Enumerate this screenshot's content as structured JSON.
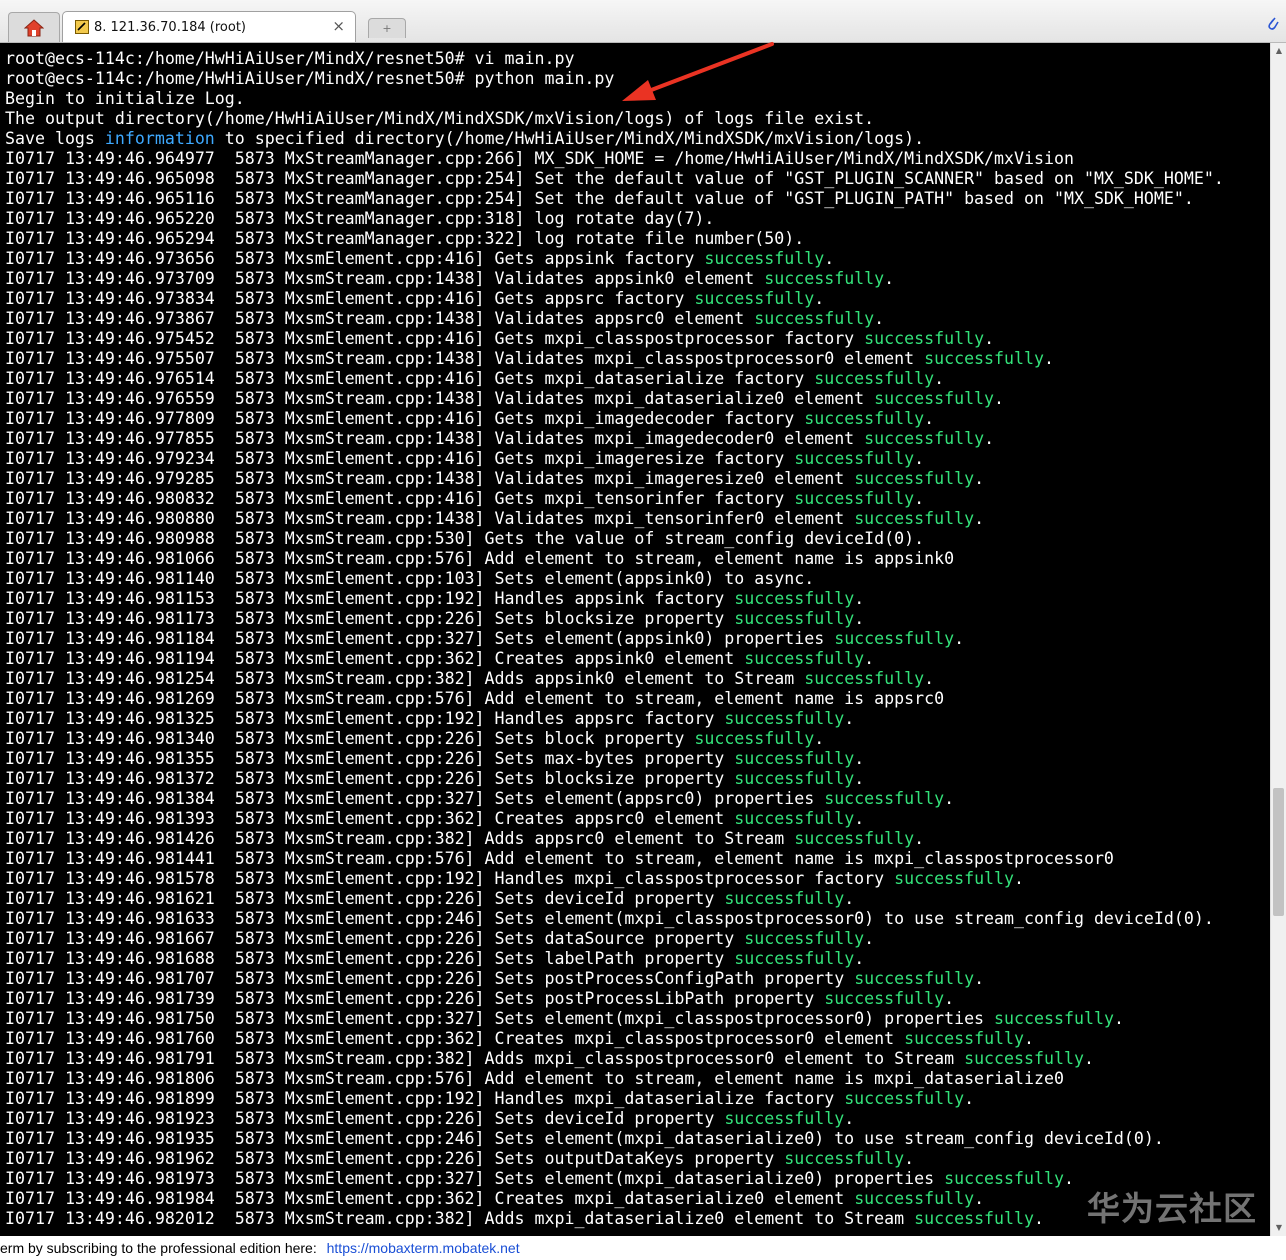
{
  "tabbar": {
    "home_icon": "home-icon",
    "session_icon": "terminal-session-icon",
    "session_label": "8. 121.36.70.184 (root)",
    "close_label": "×",
    "new_tab_label": "+",
    "attach_icon": "paperclip-icon"
  },
  "colors": {
    "terminal_bg": "#000000",
    "terminal_text": "#ffffff",
    "success_text": "#33e27a",
    "highlight_text": "#3ea9ff",
    "annotation_arrow": "#ea3323",
    "link": "#1a4fd6"
  },
  "terminal": {
    "lines": [
      [
        {
          "t": "root@ecs-114c:/home/HwHiAiUser/MindX/resnet50# vi main.py"
        }
      ],
      [
        {
          "t": "root@ecs-114c:/home/HwHiAiUser/MindX/resnet50# python main.py"
        }
      ],
      [
        {
          "t": "Begin to initialize Log."
        }
      ],
      [
        {
          "t": "The output directory(/home/HwHiAiUser/MindX/MindXSDK/mxVision/logs) of logs file exist."
        }
      ],
      [
        {
          "t": "Save logs "
        },
        {
          "t": "information",
          "c": "hl"
        },
        {
          "t": " to specified directory(/home/HwHiAiUser/MindX/MindXSDK/mxVision/logs)."
        }
      ],
      [
        {
          "t": "I0717 13:49:46.964977  5873 MxStreamManager.cpp:266] MX_SDK_HOME = /home/HwHiAiUser/MindX/MindXSDK/mxVision"
        }
      ],
      [
        {
          "t": "I0717 13:49:46.965098  5873 MxStreamManager.cpp:254] Set the default value of \"GST_PLUGIN_SCANNER\" based on \"MX_SDK_HOME\"."
        }
      ],
      [
        {
          "t": "I0717 13:49:46.965116  5873 MxStreamManager.cpp:254] Set the default value of \"GST_PLUGIN_PATH\" based on \"MX_SDK_HOME\"."
        }
      ],
      [
        {
          "t": "I0717 13:49:46.965220  5873 MxStreamManager.cpp:318] log rotate day(7)."
        }
      ],
      [
        {
          "t": "I0717 13:49:46.965294  5873 MxStreamManager.cpp:322] log rotate file number(50)."
        }
      ],
      [
        {
          "t": "I0717 13:49:46.973656  5873 MxsmElement.cpp:416] Gets appsink factory "
        },
        {
          "t": "successfully",
          "c": "ok"
        },
        {
          "t": "."
        }
      ],
      [
        {
          "t": "I0717 13:49:46.973709  5873 MxsmStream.cpp:1438] Validates appsink0 element "
        },
        {
          "t": "successfully",
          "c": "ok"
        },
        {
          "t": "."
        }
      ],
      [
        {
          "t": "I0717 13:49:46.973834  5873 MxsmElement.cpp:416] Gets appsrc factory "
        },
        {
          "t": "successfully",
          "c": "ok"
        },
        {
          "t": "."
        }
      ],
      [
        {
          "t": "I0717 13:49:46.973867  5873 MxsmStream.cpp:1438] Validates appsrc0 element "
        },
        {
          "t": "successfully",
          "c": "ok"
        },
        {
          "t": "."
        }
      ],
      [
        {
          "t": "I0717 13:49:46.975452  5873 MxsmElement.cpp:416] Gets mxpi_classpostprocessor factory "
        },
        {
          "t": "successfully",
          "c": "ok"
        },
        {
          "t": "."
        }
      ],
      [
        {
          "t": "I0717 13:49:46.975507  5873 MxsmStream.cpp:1438] Validates mxpi_classpostprocessor0 element "
        },
        {
          "t": "successfully",
          "c": "ok"
        },
        {
          "t": "."
        }
      ],
      [
        {
          "t": "I0717 13:49:46.976514  5873 MxsmElement.cpp:416] Gets mxpi_dataserialize factory "
        },
        {
          "t": "successfully",
          "c": "ok"
        },
        {
          "t": "."
        }
      ],
      [
        {
          "t": "I0717 13:49:46.976559  5873 MxsmStream.cpp:1438] Validates mxpi_dataserialize0 element "
        },
        {
          "t": "successfully",
          "c": "ok"
        },
        {
          "t": "."
        }
      ],
      [
        {
          "t": "I0717 13:49:46.977809  5873 MxsmElement.cpp:416] Gets mxpi_imagedecoder factory "
        },
        {
          "t": "successfully",
          "c": "ok"
        },
        {
          "t": "."
        }
      ],
      [
        {
          "t": "I0717 13:49:46.977855  5873 MxsmStream.cpp:1438] Validates mxpi_imagedecoder0 element "
        },
        {
          "t": "successfully",
          "c": "ok"
        },
        {
          "t": "."
        }
      ],
      [
        {
          "t": "I0717 13:49:46.979234  5873 MxsmElement.cpp:416] Gets mxpi_imageresize factory "
        },
        {
          "t": "successfully",
          "c": "ok"
        },
        {
          "t": "."
        }
      ],
      [
        {
          "t": "I0717 13:49:46.979285  5873 MxsmStream.cpp:1438] Validates mxpi_imageresize0 element "
        },
        {
          "t": "successfully",
          "c": "ok"
        },
        {
          "t": "."
        }
      ],
      [
        {
          "t": "I0717 13:49:46.980832  5873 MxsmElement.cpp:416] Gets mxpi_tensorinfer factory "
        },
        {
          "t": "successfully",
          "c": "ok"
        },
        {
          "t": "."
        }
      ],
      [
        {
          "t": "I0717 13:49:46.980880  5873 MxsmStream.cpp:1438] Validates mxpi_tensorinfer0 element "
        },
        {
          "t": "successfully",
          "c": "ok"
        },
        {
          "t": "."
        }
      ],
      [
        {
          "t": "I0717 13:49:46.980988  5873 MxsmStream.cpp:530] Gets the value of stream_config deviceId(0)."
        }
      ],
      [
        {
          "t": "I0717 13:49:46.981066  5873 MxsmStream.cpp:576] Add element to stream, element name is appsink0"
        }
      ],
      [
        {
          "t": "I0717 13:49:46.981140  5873 MxsmElement.cpp:103] Sets element(appsink0) to async."
        }
      ],
      [
        {
          "t": "I0717 13:49:46.981153  5873 MxsmElement.cpp:192] Handles appsink factory "
        },
        {
          "t": "successfully",
          "c": "ok"
        },
        {
          "t": "."
        }
      ],
      [
        {
          "t": "I0717 13:49:46.981173  5873 MxsmElement.cpp:226] Sets blocksize property "
        },
        {
          "t": "successfully",
          "c": "ok"
        },
        {
          "t": "."
        }
      ],
      [
        {
          "t": "I0717 13:49:46.981184  5873 MxsmElement.cpp:327] Sets element(appsink0) properties "
        },
        {
          "t": "successfully",
          "c": "ok"
        },
        {
          "t": "."
        }
      ],
      [
        {
          "t": "I0717 13:49:46.981194  5873 MxsmElement.cpp:362] Creates appsink0 element "
        },
        {
          "t": "successfully",
          "c": "ok"
        },
        {
          "t": "."
        }
      ],
      [
        {
          "t": "I0717 13:49:46.981254  5873 MxsmStream.cpp:382] Adds appsink0 element to Stream "
        },
        {
          "t": "successfully",
          "c": "ok"
        },
        {
          "t": "."
        }
      ],
      [
        {
          "t": "I0717 13:49:46.981269  5873 MxsmStream.cpp:576] Add element to stream, element name is appsrc0"
        }
      ],
      [
        {
          "t": "I0717 13:49:46.981325  5873 MxsmElement.cpp:192] Handles appsrc factory "
        },
        {
          "t": "successfully",
          "c": "ok"
        },
        {
          "t": "."
        }
      ],
      [
        {
          "t": "I0717 13:49:46.981340  5873 MxsmElement.cpp:226] Sets block property "
        },
        {
          "t": "successfully",
          "c": "ok"
        },
        {
          "t": "."
        }
      ],
      [
        {
          "t": "I0717 13:49:46.981355  5873 MxsmElement.cpp:226] Sets max-bytes property "
        },
        {
          "t": "successfully",
          "c": "ok"
        },
        {
          "t": "."
        }
      ],
      [
        {
          "t": "I0717 13:49:46.981372  5873 MxsmElement.cpp:226] Sets blocksize property "
        },
        {
          "t": "successfully",
          "c": "ok"
        },
        {
          "t": "."
        }
      ],
      [
        {
          "t": "I0717 13:49:46.981384  5873 MxsmElement.cpp:327] Sets element(appsrc0) properties "
        },
        {
          "t": "successfully",
          "c": "ok"
        },
        {
          "t": "."
        }
      ],
      [
        {
          "t": "I0717 13:49:46.981393  5873 MxsmElement.cpp:362] Creates appsrc0 element "
        },
        {
          "t": "successfully",
          "c": "ok"
        },
        {
          "t": "."
        }
      ],
      [
        {
          "t": "I0717 13:49:46.981426  5873 MxsmStream.cpp:382] Adds appsrc0 element to Stream "
        },
        {
          "t": "successfully",
          "c": "ok"
        },
        {
          "t": "."
        }
      ],
      [
        {
          "t": "I0717 13:49:46.981441  5873 MxsmStream.cpp:576] Add element to stream, element name is mxpi_classpostprocessor0"
        }
      ],
      [
        {
          "t": "I0717 13:49:46.981578  5873 MxsmElement.cpp:192] Handles mxpi_classpostprocessor factory "
        },
        {
          "t": "successfully",
          "c": "ok"
        },
        {
          "t": "."
        }
      ],
      [
        {
          "t": "I0717 13:49:46.981621  5873 MxsmElement.cpp:226] Sets deviceId property "
        },
        {
          "t": "successfully",
          "c": "ok"
        },
        {
          "t": "."
        }
      ],
      [
        {
          "t": "I0717 13:49:46.981633  5873 MxsmElement.cpp:246] Sets element(mxpi_classpostprocessor0) to use stream_config deviceId(0)."
        }
      ],
      [
        {
          "t": "I0717 13:49:46.981667  5873 MxsmElement.cpp:226] Sets dataSource property "
        },
        {
          "t": "successfully",
          "c": "ok"
        },
        {
          "t": "."
        }
      ],
      [
        {
          "t": "I0717 13:49:46.981688  5873 MxsmElement.cpp:226] Sets labelPath property "
        },
        {
          "t": "successfully",
          "c": "ok"
        },
        {
          "t": "."
        }
      ],
      [
        {
          "t": "I0717 13:49:46.981707  5873 MxsmElement.cpp:226] Sets postProcessConfigPath property "
        },
        {
          "t": "successfully",
          "c": "ok"
        },
        {
          "t": "."
        }
      ],
      [
        {
          "t": "I0717 13:49:46.981739  5873 MxsmElement.cpp:226] Sets postProcessLibPath property "
        },
        {
          "t": "successfully",
          "c": "ok"
        },
        {
          "t": "."
        }
      ],
      [
        {
          "t": "I0717 13:49:46.981750  5873 MxsmElement.cpp:327] Sets element(mxpi_classpostprocessor0) properties "
        },
        {
          "t": "successfully",
          "c": "ok"
        },
        {
          "t": "."
        }
      ],
      [
        {
          "t": "I0717 13:49:46.981760  5873 MxsmElement.cpp:362] Creates mxpi_classpostprocessor0 element "
        },
        {
          "t": "successfully",
          "c": "ok"
        },
        {
          "t": "."
        }
      ],
      [
        {
          "t": "I0717 13:49:46.981791  5873 MxsmStream.cpp:382] Adds mxpi_classpostprocessor0 element to Stream "
        },
        {
          "t": "successfully",
          "c": "ok"
        },
        {
          "t": "."
        }
      ],
      [
        {
          "t": "I0717 13:49:46.981806  5873 MxsmStream.cpp:576] Add element to stream, element name is mxpi_dataserialize0"
        }
      ],
      [
        {
          "t": "I0717 13:49:46.981899  5873 MxsmElement.cpp:192] Handles mxpi_dataserialize factory "
        },
        {
          "t": "successfully",
          "c": "ok"
        },
        {
          "t": "."
        }
      ],
      [
        {
          "t": "I0717 13:49:46.981923  5873 MxsmElement.cpp:226] Sets deviceId property "
        },
        {
          "t": "successfully",
          "c": "ok"
        },
        {
          "t": "."
        }
      ],
      [
        {
          "t": "I0717 13:49:46.981935  5873 MxsmElement.cpp:246] Sets element(mxpi_dataserialize0) to use stream_config deviceId(0)."
        }
      ],
      [
        {
          "t": "I0717 13:49:46.981962  5873 MxsmElement.cpp:226] Sets outputDataKeys property "
        },
        {
          "t": "successfully",
          "c": "ok"
        },
        {
          "t": "."
        }
      ],
      [
        {
          "t": "I0717 13:49:46.981973  5873 MxsmElement.cpp:327] Sets element(mxpi_dataserialize0) properties "
        },
        {
          "t": "successfully",
          "c": "ok"
        },
        {
          "t": "."
        }
      ],
      [
        {
          "t": "I0717 13:49:46.981984  5873 MxsmElement.cpp:362] Creates mxpi_dataserialize0 element "
        },
        {
          "t": "successfully",
          "c": "ok"
        },
        {
          "t": "."
        }
      ],
      [
        {
          "t": "I0717 13:49:46.982012  5873 MxsmStream.cpp:382] Adds mxpi_dataserialize0 element to Stream "
        },
        {
          "t": "successfully",
          "c": "ok"
        },
        {
          "t": "."
        }
      ]
    ]
  },
  "watermark": {
    "text": "华为云社区"
  },
  "statusbar": {
    "text": "erm by subscribing to the professional edition here:",
    "link_text": "https://mobaxterm.mobatek.net"
  }
}
